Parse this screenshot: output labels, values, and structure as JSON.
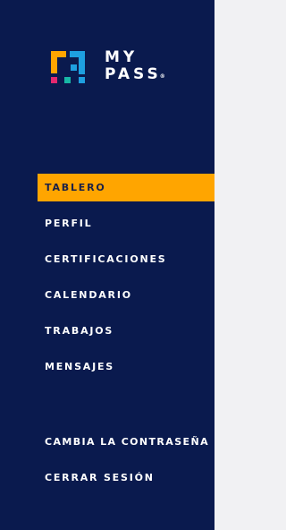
{
  "brand": {
    "line1": "MY",
    "line2": "PASS",
    "registered": "®"
  },
  "colors": {
    "sidebar_bg": "#0a1a4e",
    "active_bg": "#ffa500",
    "content_bg": "#f1f1f3",
    "logo_orange": "#ffa500",
    "logo_blue": "#1e9fe0",
    "logo_pink": "#e4286f",
    "logo_teal": "#18b8a6"
  },
  "nav": {
    "items": [
      {
        "label": "TABLERO",
        "icon": "",
        "active": true
      },
      {
        "label": "PERFIL",
        "icon": "",
        "active": false
      },
      {
        "label": "CERTIFICACIONES",
        "icon": "",
        "active": false
      },
      {
        "label": "CALENDARIO",
        "icon": "",
        "active": false
      },
      {
        "label": "TRABAJOS",
        "icon": "",
        "active": false
      },
      {
        "label": "MENSAJES",
        "icon": "",
        "active": false
      }
    ],
    "account": [
      {
        "label": "CAMBIA LA CONTRASEÑA"
      },
      {
        "label": "CERRAR SESIÓN"
      }
    ]
  }
}
